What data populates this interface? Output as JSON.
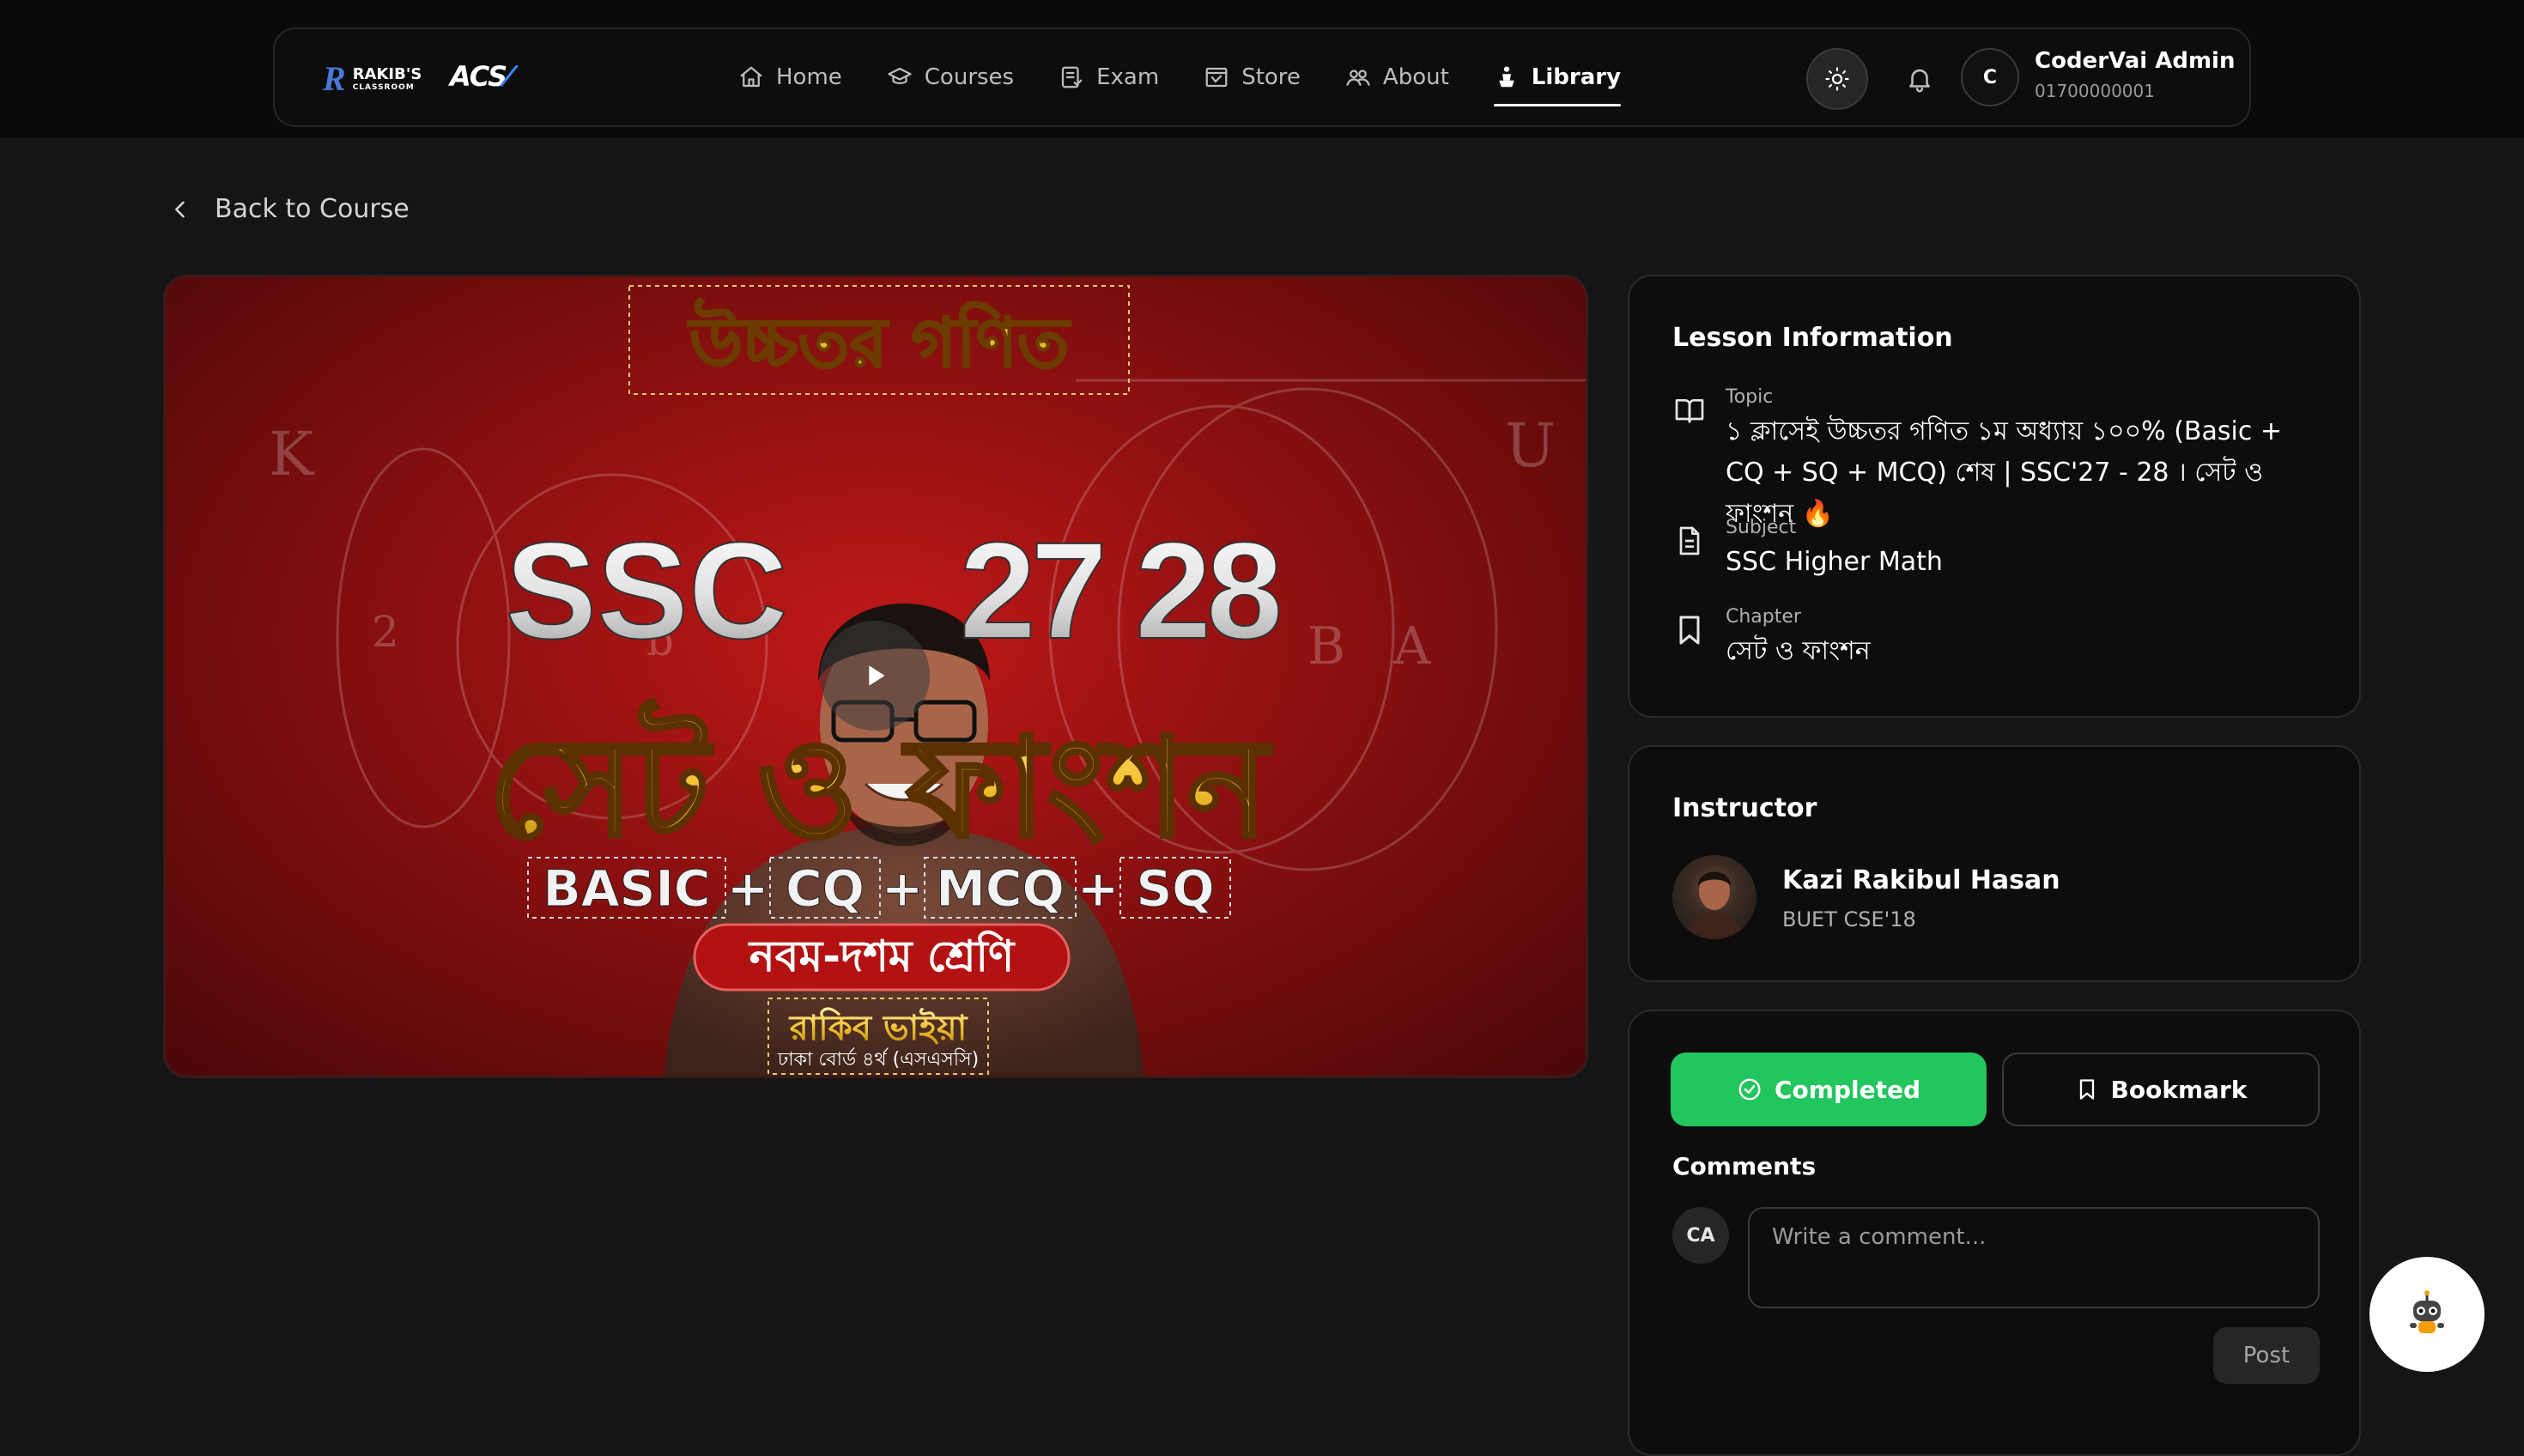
{
  "brand": {
    "rakib_line1": "RAKIB'S",
    "rakib_line2": "CLASSROOM",
    "acs": "ACS"
  },
  "nav": {
    "items": [
      {
        "label": "Home",
        "icon": "home-icon"
      },
      {
        "label": "Courses",
        "icon": "graduation-cap-icon"
      },
      {
        "label": "Exam",
        "icon": "exam-icon"
      },
      {
        "label": "Store",
        "icon": "store-icon"
      },
      {
        "label": "About",
        "icon": "users-icon"
      },
      {
        "label": "Library",
        "icon": "library-icon",
        "active": true
      }
    ]
  },
  "user": {
    "initial": "C",
    "name": "CoderVai Admin",
    "phone": "01700000001"
  },
  "back_label": "Back to Course",
  "video": {
    "thumb_title": "উচ্চতর গণিত",
    "ssc": "SSC",
    "years": "27 28",
    "topic_big": "সেট ও ফাংশন",
    "tags": [
      "BASIC",
      "CQ",
      "MCQ",
      "SQ"
    ],
    "class_label": "নবম-দশম শ্রেণি",
    "teacher_tag": "রাকিব ভাইয়া",
    "teacher_sub": "ঢাকা বোর্ড ৪র্থ (এসএসসি)"
  },
  "lesson_info": {
    "title": "Lesson Information",
    "topic_label": "Topic",
    "topic_value": "১ ক্লাসেই উচ্চতর গণিত ১ম অধ্যায় ১০০% (Basic + CQ + SQ + MCQ) শেষ | SSC'27 - 28 । সেট ও ফাংশন 🔥",
    "subject_label": "Subject",
    "subject_value": "SSC Higher Math",
    "chapter_label": "Chapter",
    "chapter_value": "সেট ও ফাংশন"
  },
  "instructor": {
    "title": "Instructor",
    "name": "Kazi Rakibul Hasan",
    "affiliation": "BUET CSE'18"
  },
  "actions": {
    "completed_label": "Completed",
    "bookmark_label": "Bookmark",
    "completed_color": "#22c55e"
  },
  "comments": {
    "title": "Comments",
    "avatar_initials": "CA",
    "placeholder": "Write a comment...",
    "post_label": "Post"
  }
}
